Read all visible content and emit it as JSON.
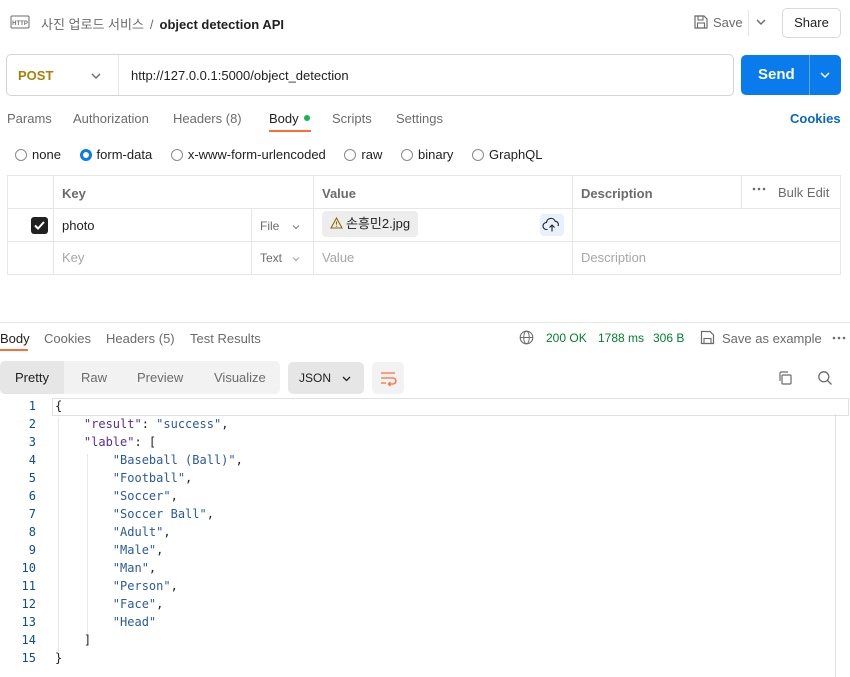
{
  "header": {
    "collection": "사진 업로드 서비스",
    "separator": "/",
    "request_name": "object detection API",
    "save_label": "Save",
    "share_label": "Share"
  },
  "request": {
    "method": "POST",
    "url": "http://127.0.0.1:5000/object_detection",
    "send_label": "Send"
  },
  "request_tabs": {
    "params": "Params",
    "authorization": "Authorization",
    "headers": "Headers (8)",
    "body": "Body",
    "scripts": "Scripts",
    "settings": "Settings",
    "cookies": "Cookies"
  },
  "body_types": {
    "none": "none",
    "form_data": "form-data",
    "urlencoded": "x-www-form-urlencoded",
    "raw": "raw",
    "binary": "binary",
    "graphql": "GraphQL",
    "selected": "form-data"
  },
  "form_table": {
    "headers": {
      "key": "Key",
      "value": "Value",
      "description": "Description",
      "bulk_edit": "Bulk Edit"
    },
    "row": {
      "key": "photo",
      "type": "File",
      "value": "손흥민2.jpg",
      "checked": true
    },
    "placeholder_row": {
      "key": "Key",
      "type": "Text",
      "value": "Value",
      "description": "Description"
    }
  },
  "response_tabs": {
    "body": "Body",
    "cookies": "Cookies",
    "headers": "Headers (5)",
    "test_results": "Test Results"
  },
  "response_status": {
    "status": "200 OK",
    "time": "1788 ms",
    "size": "306 B",
    "save_example": "Save as example"
  },
  "response_view": {
    "pretty": "Pretty",
    "raw": "Raw",
    "preview": "Preview",
    "visualize": "Visualize",
    "format": "JSON"
  },
  "code_lines": [
    {
      "n": "1",
      "t": "{"
    },
    {
      "n": "2",
      "t": "    \"result\": \"success\","
    },
    {
      "n": "3",
      "t": "    \"lable\": ["
    },
    {
      "n": "4",
      "t": "        \"Baseball (Ball)\","
    },
    {
      "n": "5",
      "t": "        \"Football\","
    },
    {
      "n": "6",
      "t": "        \"Soccer\","
    },
    {
      "n": "7",
      "t": "        \"Soccer Ball\","
    },
    {
      "n": "8",
      "t": "        \"Adult\","
    },
    {
      "n": "9",
      "t": "        \"Male\","
    },
    {
      "n": "10",
      "t": "        \"Man\","
    },
    {
      "n": "11",
      "t": "        \"Person\","
    },
    {
      "n": "12",
      "t": "        \"Face\","
    },
    {
      "n": "13",
      "t": "        \"Head\""
    },
    {
      "n": "14",
      "t": "    ]"
    },
    {
      "n": "15",
      "t": "}"
    }
  ],
  "colors": {
    "accent": "#ff6c37",
    "send": "#097bed",
    "method_post": "#a97f08",
    "status_ok": "#007f31",
    "link": "#0b66c8"
  }
}
